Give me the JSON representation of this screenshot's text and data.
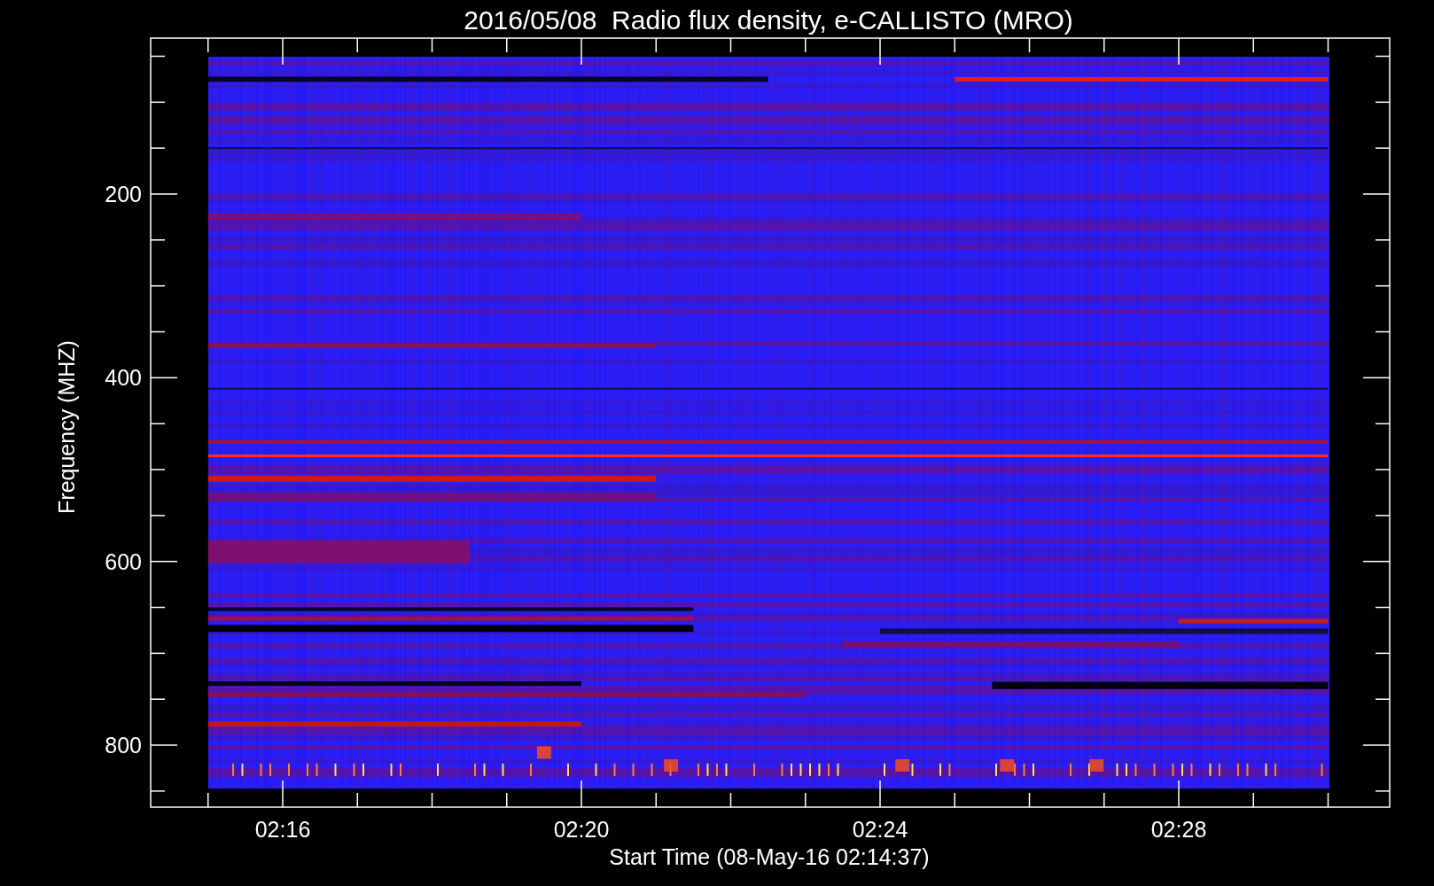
{
  "title": "2016/05/08  Radio flux density, e-CALLISTO (MRO)",
  "y_axis": {
    "label": "Frequency (MHZ)",
    "ticks": [
      "200",
      "400",
      "600",
      "800"
    ]
  },
  "x_axis": {
    "label": "Start Time (08-May-16 02:14:37)",
    "ticks": [
      "02:16",
      "02:20",
      "02:24",
      "02:28"
    ]
  }
}
